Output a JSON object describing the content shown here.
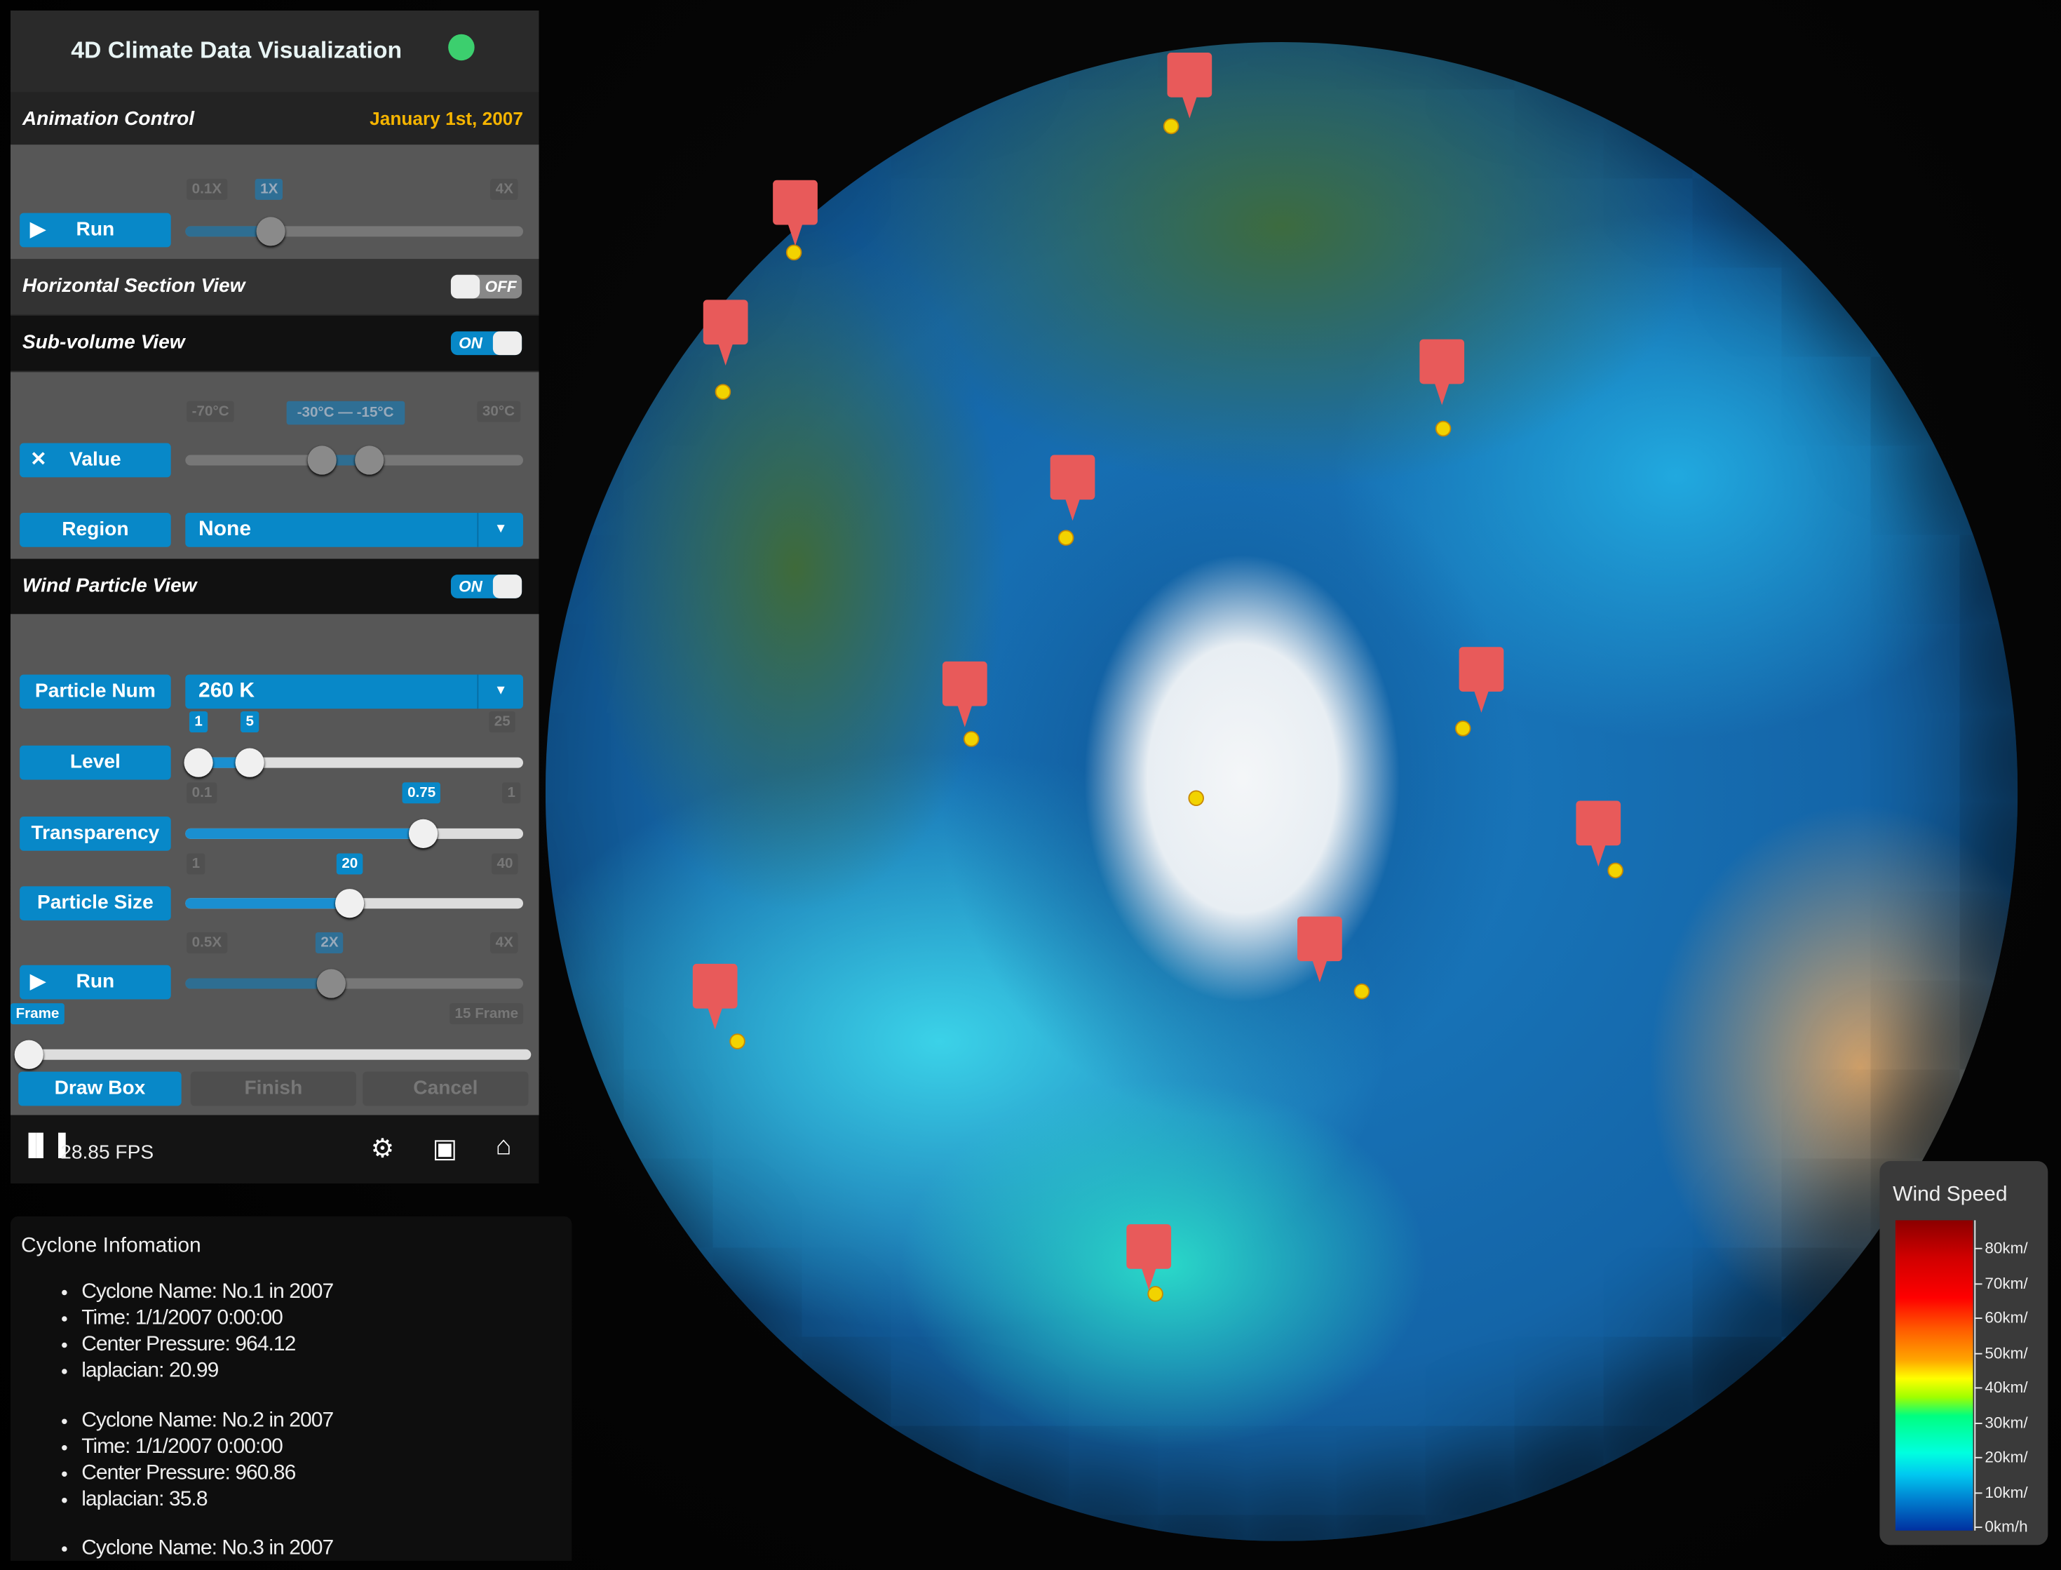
{
  "app_title": "4D Climate Data Visualization",
  "animation": {
    "section_label": "Animation Control",
    "date": "January 1st, 2007",
    "speed_ticks": {
      "min": "0.1X",
      "current": "1X",
      "max": "4X"
    },
    "speed_fraction": 0.25,
    "run_label": "Run"
  },
  "horizontal_section": {
    "label": "Horizontal Section View",
    "state": "OFF"
  },
  "subvolume": {
    "label": "Sub-volume View",
    "state": "ON",
    "value_ticks": {
      "min": "-70°C",
      "current": "-30°C — -15°C",
      "max": "30°C"
    },
    "value_range_fraction": [
      0.4,
      0.55
    ],
    "value_label": "Value",
    "region_label": "Region",
    "region_value": "None"
  },
  "wind_particle": {
    "label": "Wind Particle View",
    "state": "ON",
    "particle_num_label": "Particle Num",
    "particle_num_value": "260 K",
    "level": {
      "label": "Level",
      "low": "1",
      "high": "5",
      "max": "25"
    },
    "transparency": {
      "label": "Transparency",
      "min": "0.1",
      "current": "0.75",
      "max": "1"
    },
    "particle_size": {
      "label": "Particle Size",
      "min": "1",
      "current": "20",
      "max": "40"
    },
    "speed": {
      "min": "0.5X",
      "current": "2X",
      "max": "4X",
      "run_label": "Run"
    },
    "frame": {
      "label": "Frame",
      "max": "15 Frame"
    },
    "draw_box": "Draw Box",
    "finish": "Finish",
    "cancel": "Cancel"
  },
  "footer": {
    "fps": "28.85 FPS"
  },
  "cyclone_info": {
    "title": "Cyclone Infomation",
    "cyclones": [
      [
        "Cyclone Name: No.1 in 2007",
        "Time: 1/1/2007 0:00:00",
        "Center Pressure: 964.12",
        "laplacian: 20.99"
      ],
      [
        "Cyclone Name: No.2 in 2007",
        "Time: 1/1/2007 0:00:00",
        "Center Pressure: 960.86",
        "laplacian: 35.8"
      ],
      [
        "Cyclone Name: No.3 in 2007"
      ]
    ]
  },
  "legend": {
    "title": "Wind Speed",
    "labels": [
      "80km/",
      "70km/",
      "60km/",
      "50km/",
      "40km/",
      "30km/",
      "20km/",
      "10km/",
      "0km/h"
    ]
  },
  "colors": {
    "accent": "#0888c8",
    "date": "#f5b400",
    "marker": "#e85a5a",
    "marker_dot": "#f2d300"
  }
}
